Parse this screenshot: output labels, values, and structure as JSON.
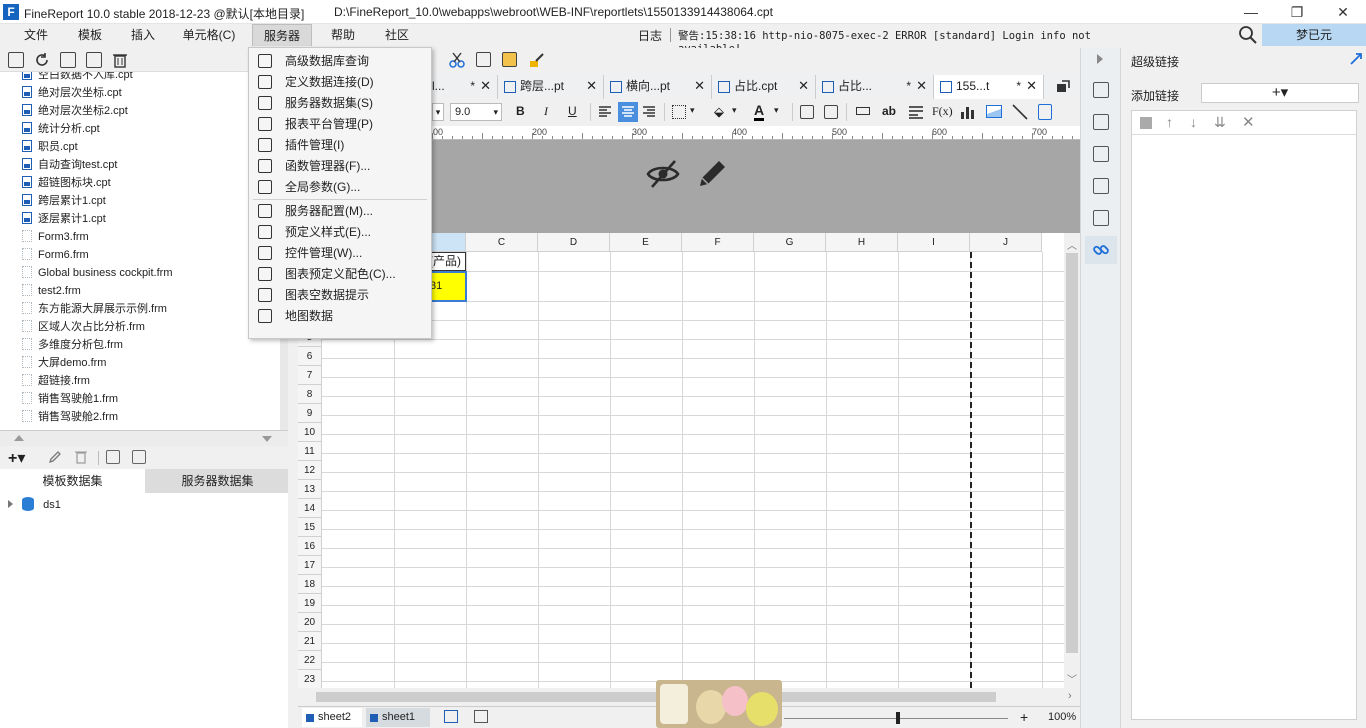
{
  "window": {
    "title": "FineReport 10.0 stable 2018-12-23 @默认[本地目录]",
    "path": "D:\\FineReport_10.0\\webapps\\webroot\\WEB-INF\\reportlets\\1550133914438064.cpt",
    "logo": "F",
    "minimize": "—",
    "restore": "❐",
    "close": "✕"
  },
  "menu": {
    "items": [
      "文件",
      "模板",
      "插入",
      "单元格(C)",
      "服务器",
      "帮助",
      "社区"
    ],
    "active": "服务器",
    "log_label": "日志",
    "log_message": "警告:15:38:16 http-nio-8075-exec-2 ERROR [standard] Login info not available!",
    "user": "梦已元"
  },
  "server_menu": {
    "items": [
      {
        "label": "高级数据库查询",
        "icon": "database-query-icon"
      },
      {
        "label": "定义数据连接(D)",
        "icon": "data-connection-icon"
      },
      {
        "label": "服务器数据集(S)",
        "icon": "server-dataset-icon"
      },
      {
        "label": "报表平台管理(P)",
        "icon": "platform-user-icon"
      },
      {
        "label": "插件管理(I)",
        "icon": "plugin-icon"
      },
      {
        "label": "函数管理器(F)...",
        "icon": "function-manager-icon"
      },
      {
        "label": "全局参数(G)...",
        "icon": "global-param-icon"
      },
      {
        "label": "服务器配置(M)...",
        "icon": "server-config-icon"
      },
      {
        "label": "预定义样式(E)...",
        "icon": "predefined-style-icon"
      },
      {
        "label": "控件管理(W)...",
        "icon": "widget-manager-icon"
      },
      {
        "label": "图表预定义配色(C)...",
        "icon": "chart-color-icon"
      },
      {
        "label": "图表空数据提示",
        "icon": "chart-empty-icon"
      },
      {
        "label": "地图数据",
        "icon": "map-data-icon"
      }
    ]
  },
  "file_tree": {
    "items": [
      {
        "name": "空白数据不入库.cpt",
        "type": "cpt"
      },
      {
        "name": "绝对层次坐标.cpt",
        "type": "cpt"
      },
      {
        "name": "绝对层次坐标2.cpt",
        "type": "cpt"
      },
      {
        "name": "统计分析.cpt",
        "type": "cpt"
      },
      {
        "name": "职员.cpt",
        "type": "cpt"
      },
      {
        "name": "自动查询test.cpt",
        "type": "cpt"
      },
      {
        "name": "超链图标块.cpt",
        "type": "cpt"
      },
      {
        "name": "跨层累计1.cpt",
        "type": "cpt"
      },
      {
        "name": "逐层累计1.cpt",
        "type": "cpt"
      },
      {
        "name": "Form3.frm",
        "type": "frm"
      },
      {
        "name": "Form6.frm",
        "type": "frm"
      },
      {
        "name": "Global business cockpit.frm",
        "type": "frm"
      },
      {
        "name": "test2.frm",
        "type": "frm"
      },
      {
        "name": "东方能源大屏展示示例.frm",
        "type": "frm"
      },
      {
        "name": "区域人次占比分析.frm",
        "type": "frm"
      },
      {
        "name": "多维度分析包.frm",
        "type": "frm"
      },
      {
        "name": "大屏demo.frm",
        "type": "frm"
      },
      {
        "name": "超链接.frm",
        "type": "frm"
      },
      {
        "name": "销售驾驶舱1.frm",
        "type": "frm"
      },
      {
        "name": "销售驾驶舱2.frm",
        "type": "frm"
      }
    ]
  },
  "dataset_panel": {
    "tabs": [
      "模板数据集",
      "服务器数据集"
    ],
    "active_tab": "服务器数据集",
    "items": [
      "ds1"
    ],
    "add_label": "+▾"
  },
  "editor_tabs": [
    {
      "label": "l...",
      "modified": true
    },
    {
      "label": "跨层...pt",
      "modified": false
    },
    {
      "label": "横向...pt",
      "modified": false
    },
    {
      "label": "占比.cpt",
      "modified": false
    },
    {
      "label": "占比...",
      "modified": true
    },
    {
      "label": "155...t",
      "modified": true,
      "active": true
    }
  ],
  "format_toolbar": {
    "font_size": "9.0",
    "bold": "B",
    "italic": "I",
    "underline": "U",
    "formula": "F(x)",
    "ab": "ab"
  },
  "ruler": {
    "marks": [
      "100",
      "200",
      "300",
      "400",
      "500",
      "600",
      "700"
    ]
  },
  "sheet": {
    "columns": [
      "B",
      "C",
      "D",
      "E",
      "F",
      "G",
      "H",
      "I",
      "J"
    ],
    "rows": [
      "1",
      "2",
      "3",
      "4",
      "5",
      "6",
      "7",
      "8",
      "9",
      "10",
      "11",
      "12",
      "13",
      "14",
      "15",
      "16",
      "17",
      "18",
      "19",
      "20",
      "21",
      "22",
      "23"
    ],
    "cell_b1": "(产品)",
    "cell_b2": "31",
    "tabs": [
      "sheet2",
      "sheet1"
    ],
    "zoom": "100%",
    "selected_fill": "#ffff00"
  },
  "right_panel": {
    "title": "超级链接",
    "add_link_label": "添加链接",
    "add_button": "+▾"
  },
  "colors": {
    "accent": "#1e6fd9",
    "user_box": "#b8d7f2",
    "canvas_gray": "#a6a6a6"
  }
}
